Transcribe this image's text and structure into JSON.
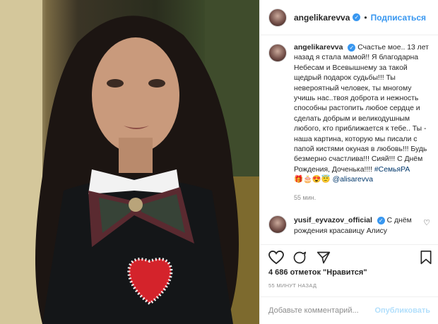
{
  "post": {
    "author": "angelikarevva",
    "verified_icon": "verified-badge-icon",
    "follow_sep": "•",
    "follow_label": "Подписаться"
  },
  "caption": {
    "username": "angelikarevva",
    "text": "Счастье мое.. 13 лет назад я стала мамой!! Я благодарна Небесам и Всевышнему за такой щедрый подарок судьбы!!! Ты невероятный человек, ты многому учишь нас..твоя доброта и нежность способны растопить любое сердце и сделать добрым и великодушным любого, кто приближается к тебе.. Ты - наша картина, которую мы писали с папой кистями окуная в любовь!!! Будь безмерно счастлива!!! Сияй!!! С Днём Рождения, Доченька!!!! ",
    "hashtag": "#СемьяРА",
    "emojis": "🎁🎂😍😇",
    "mention": "@alisarevva",
    "time": "55 мин."
  },
  "comment": {
    "username": "yusif_eyvazov_official",
    "text": "С днём рождения красавицу Алису"
  },
  "likes_text": "4 686 отметок \"Нравится\"",
  "posted_ago": "55 МИНУТ НАЗАД",
  "add_comment": {
    "placeholder": "Добавьте комментарий...",
    "publish_label": "Опубликовать"
  },
  "colors": {
    "link": "#3897f0",
    "publish_disabled": "#b2dffc",
    "muted": "#8e8e8e"
  }
}
